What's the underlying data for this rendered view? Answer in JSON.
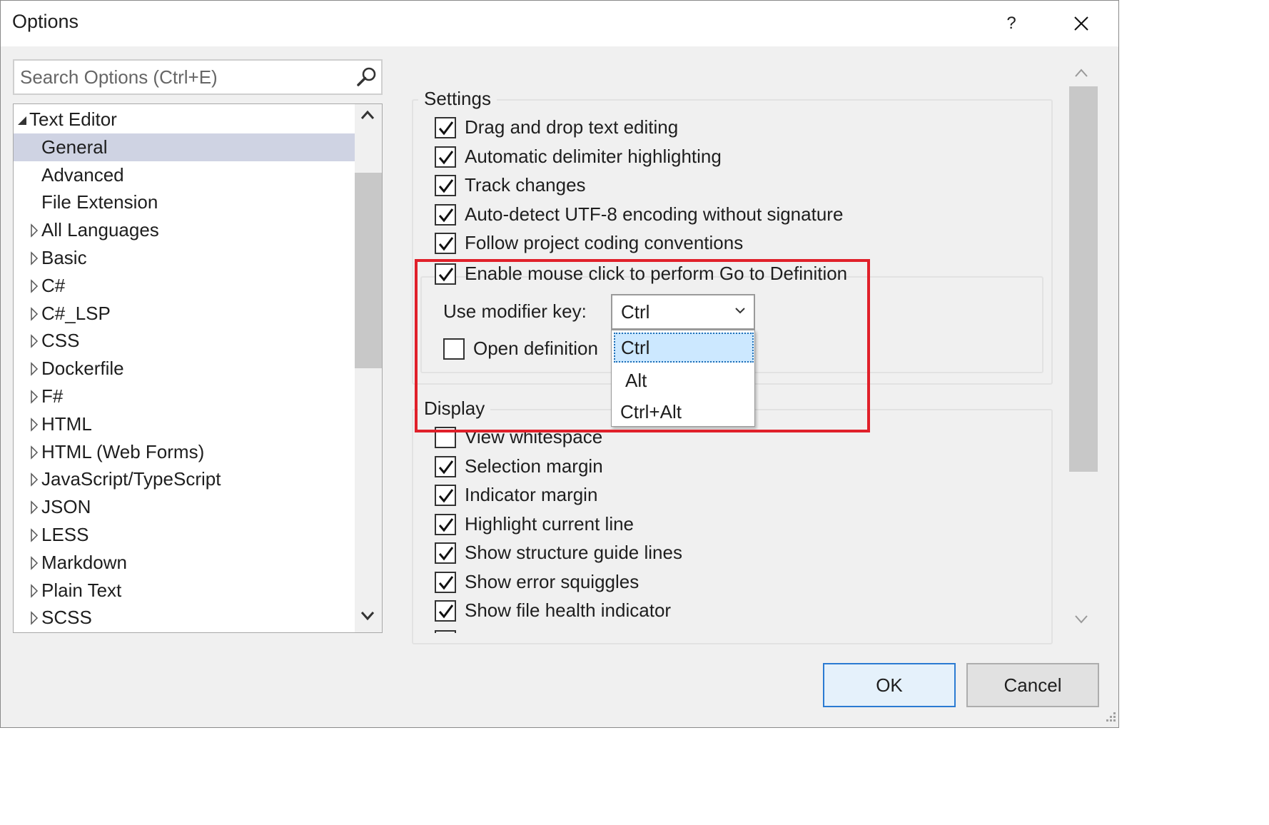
{
  "window": {
    "title": "Options",
    "help_label": "?",
    "close_icon": "close-icon"
  },
  "search": {
    "placeholder": "Search Options (Ctrl+E)",
    "icon": "search-icon"
  },
  "tree": {
    "items": [
      {
        "label": "Text Editor",
        "state": "expanded"
      },
      {
        "label": "General",
        "selected": true
      },
      {
        "label": "Advanced"
      },
      {
        "label": "File Extension"
      },
      {
        "label": "All Languages",
        "state": "collapsed"
      },
      {
        "label": "Basic",
        "state": "collapsed"
      },
      {
        "label": "C#",
        "state": "collapsed"
      },
      {
        "label": "C#_LSP",
        "state": "collapsed"
      },
      {
        "label": "CSS",
        "state": "collapsed"
      },
      {
        "label": "Dockerfile",
        "state": "collapsed"
      },
      {
        "label": "F#",
        "state": "collapsed"
      },
      {
        "label": "HTML",
        "state": "collapsed"
      },
      {
        "label": "HTML (Web Forms)",
        "state": "collapsed"
      },
      {
        "label": "JavaScript/TypeScript",
        "state": "collapsed"
      },
      {
        "label": "JSON",
        "state": "collapsed"
      },
      {
        "label": "LESS",
        "state": "collapsed"
      },
      {
        "label": "Markdown",
        "state": "collapsed"
      },
      {
        "label": "Plain Text",
        "state": "collapsed"
      },
      {
        "label": "SCSS",
        "state": "collapsed"
      }
    ]
  },
  "settings": {
    "group_label": "Settings",
    "checkboxes": [
      {
        "label": "Drag and drop text editing",
        "checked": true
      },
      {
        "label": "Automatic delimiter highlighting",
        "checked": true
      },
      {
        "label": "Track changes",
        "checked": true
      },
      {
        "label": "Auto-detect UTF-8 encoding without signature",
        "checked": true
      },
      {
        "label": "Follow project coding conventions",
        "checked": true
      }
    ],
    "goto_definition": {
      "label": "Enable mouse click to perform Go to Definition",
      "checked": true,
      "modifier_label": "Use modifier key:",
      "modifier_value": "Ctrl",
      "open_definition_label": "Open definition",
      "open_definition_checked": false,
      "options": [
        "Ctrl",
        "Alt",
        "Ctrl+Alt"
      ],
      "selected_option": "Ctrl"
    }
  },
  "display": {
    "group_label": "Display",
    "checkboxes": [
      {
        "label": "View whitespace",
        "checked": false
      },
      {
        "label": "Selection margin",
        "checked": true
      },
      {
        "label": "Indicator margin",
        "checked": true
      },
      {
        "label": "Highlight current line",
        "checked": true
      },
      {
        "label": "Show structure guide lines",
        "checked": true
      },
      {
        "label": "Show error squiggles",
        "checked": true
      },
      {
        "label": "Show file health indicator",
        "checked": true
      }
    ]
  },
  "buttons": {
    "ok": "OK",
    "cancel": "Cancel"
  },
  "colors": {
    "highlight_border": "#e0202a",
    "selected_tree_item": "#cfd3e3",
    "selected_dropdown_item": "#cce8ff",
    "ok_button_border": "#2b7bd2"
  }
}
